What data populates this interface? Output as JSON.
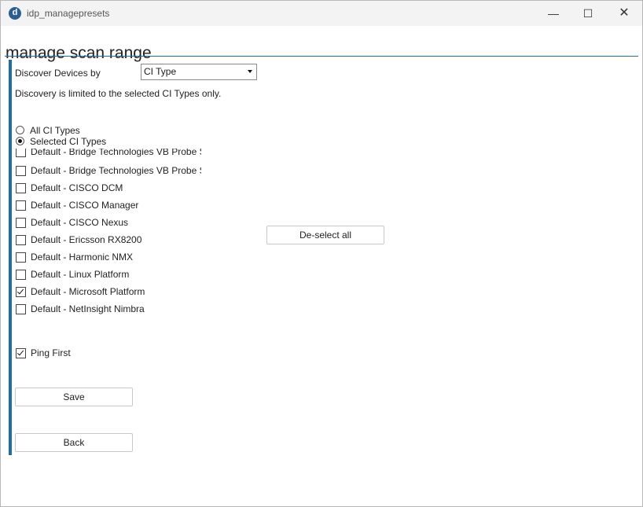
{
  "window": {
    "title": "idp_managepresets",
    "minimize_glyph": "—",
    "maximize_glyph": "☐",
    "close_glyph": "✕",
    "app_icon_letter": "d"
  },
  "page": {
    "title": "manage scan range",
    "accent_color": "#1f6fa6"
  },
  "discover": {
    "label": "Discover Devices by",
    "selected": "CI Type",
    "info": "Discovery is limited to the selected CI Types only."
  },
  "scope": {
    "options": [
      {
        "label": "All CI Types",
        "selected": false
      },
      {
        "label": "Selected CI Types",
        "selected": true
      }
    ]
  },
  "ci_types": [
    {
      "label": "Default - Bridge Technologies VB Probe S",
      "checked": false
    },
    {
      "label": "Default - Bridge Technologies VB Probe S",
      "checked": false
    },
    {
      "label": "Default - CISCO DCM",
      "checked": false
    },
    {
      "label": "Default - CISCO Manager",
      "checked": false
    },
    {
      "label": "Default - CISCO Nexus",
      "checked": false
    },
    {
      "label": "Default - Ericsson RX8200",
      "checked": false
    },
    {
      "label": "Default - Harmonic NMX",
      "checked": false
    },
    {
      "label": "Default - Linux Platform",
      "checked": false
    },
    {
      "label": "Default - Microsoft Platform",
      "checked": true
    },
    {
      "label": "Default - NetInsight Nimbra",
      "checked": false
    }
  ],
  "deselect_all_label": "De-select all",
  "ping_first": {
    "label": "Ping First",
    "checked": true
  },
  "save_label": "Save",
  "back_label": "Back"
}
